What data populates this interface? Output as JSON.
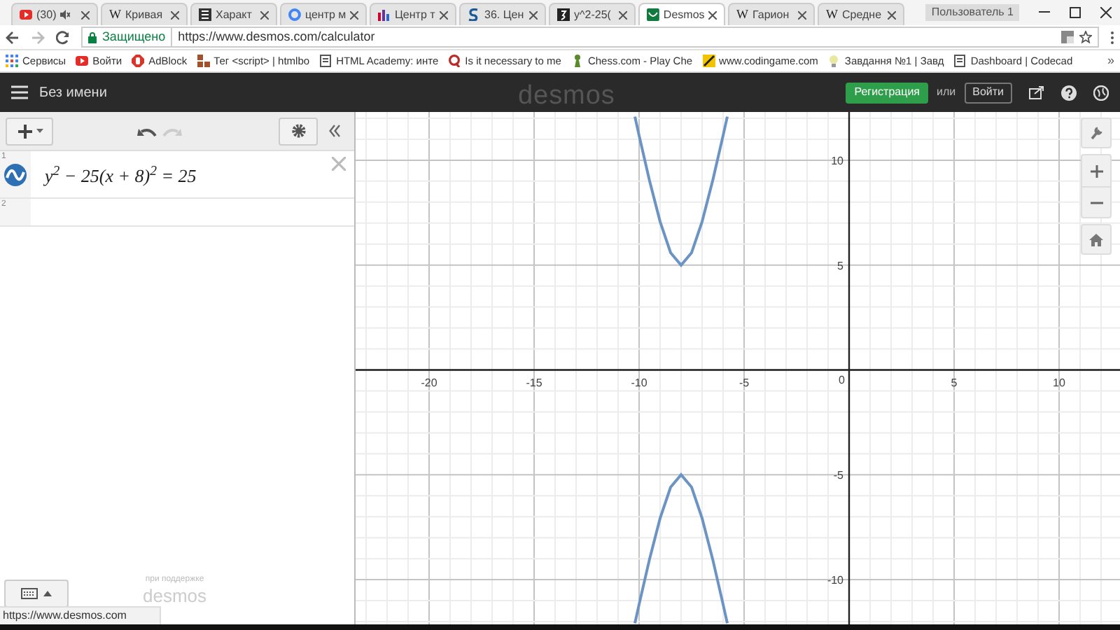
{
  "browser": {
    "tabs": [
      {
        "title": "(30)",
        "kind": "youtube",
        "muted": true,
        "selected": false
      },
      {
        "title": "Кривая",
        "kind": "wiki",
        "favicon_text": "W",
        "muted": false,
        "selected": false
      },
      {
        "title": "Характ",
        "kind": "doc",
        "muted": false,
        "selected": false
      },
      {
        "title": "центр м",
        "kind": "google",
        "muted": false,
        "selected": false
      },
      {
        "title": "Центр т",
        "kind": "chart",
        "muted": false,
        "selected": false
      },
      {
        "title": "36. Цен",
        "kind": "s",
        "muted": false,
        "selected": false
      },
      {
        "title": "y^2-25(",
        "kind": "dark",
        "muted": false,
        "selected": false
      },
      {
        "title": "Desmos",
        "kind": "desmos",
        "muted": false,
        "selected": true
      },
      {
        "title": "Гарион",
        "kind": "wiki",
        "favicon_text": "W",
        "muted": false,
        "selected": false
      },
      {
        "title": "Средне",
        "kind": "wiki",
        "favicon_text": "W",
        "muted": false,
        "selected": false
      }
    ],
    "profile": "Пользователь 1",
    "security": "Защищено",
    "url": "https://www.desmos.com/calculator",
    "bookmarks": [
      {
        "label": "Сервисы",
        "kind": "apps"
      },
      {
        "label": "Войти",
        "kind": "youtube"
      },
      {
        "label": "AdBlock",
        "kind": "adblock"
      },
      {
        "label": "Тег <script> | htmlbo",
        "kind": "blocks"
      },
      {
        "label": "HTML Academy: инте",
        "kind": "page"
      },
      {
        "label": "Is it necessary to me",
        "kind": "quora"
      },
      {
        "label": "Chess.com - Play Che",
        "kind": "pawn"
      },
      {
        "label": "www.codingame.com",
        "kind": "code"
      },
      {
        "label": "Завдання №1 | Завд",
        "kind": "bulb"
      },
      {
        "label": "Dashboard | Codecad",
        "kind": "page"
      }
    ],
    "bookmarks_more": "»"
  },
  "app": {
    "title": "Без имени",
    "logo": "desmos",
    "signup": "Регистрация",
    "or": "или",
    "login": "Войти"
  },
  "expressions": [
    {
      "number": "1",
      "latex": "y$^{2}$ − 25(x + 8)$^{2}$ = 25",
      "shown": true
    },
    {
      "number": "2"
    }
  ],
  "powered_by": "при поддержке",
  "powered_logo": "desmos",
  "status_url": "https://www.desmos.com",
  "graph": {
    "origin_label": "0",
    "chart_data": {
      "type": "line",
      "grid": true,
      "xlim": [
        -23.5,
        12.9
      ],
      "ylim": [
        -12.2,
        12.3
      ],
      "xticks": [
        -20,
        -15,
        -10,
        -5,
        5,
        10
      ],
      "yticks": [
        -10,
        -5,
        5,
        10
      ],
      "x": [
        -10.2,
        -10,
        -9.5,
        -9,
        -8.5,
        -8,
        -7.5,
        -7,
        -6.5,
        -6,
        -5.8
      ],
      "series": [
        {
          "color": "#6b94c4",
          "values": [
            12.08,
            11.18,
            9.01,
            7.07,
            5.59,
            5,
            5.59,
            7.07,
            9.01,
            11.18,
            12.08
          ]
        },
        {
          "color": "#6b94c4",
          "values": [
            -12.08,
            -11.18,
            -9.01,
            -7.07,
            -5.59,
            -5,
            -5.59,
            -7.07,
            -9.01,
            -11.18,
            -12.08
          ]
        }
      ]
    }
  }
}
